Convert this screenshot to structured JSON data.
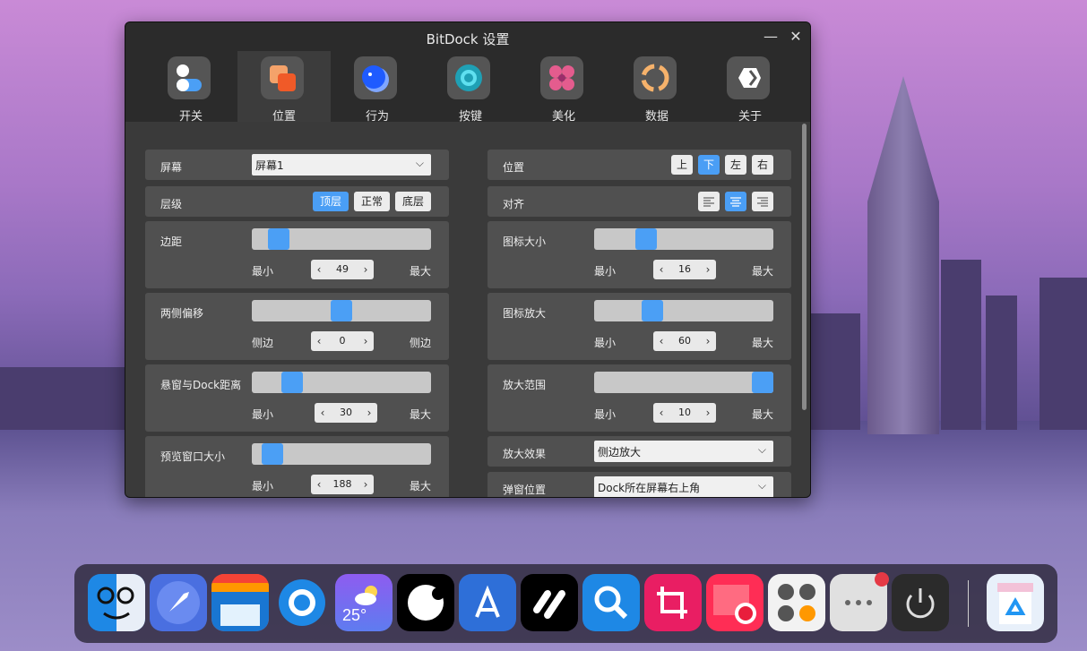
{
  "window": {
    "title": "BitDock 设置",
    "minimize_glyph": "—",
    "close_glyph": "✕"
  },
  "tabs": [
    {
      "label": "开关",
      "icon": "toggles-icon"
    },
    {
      "label": "位置",
      "icon": "layers-icon",
      "active": true
    },
    {
      "label": "行为",
      "icon": "circle-icon"
    },
    {
      "label": "按键",
      "icon": "ring-icon"
    },
    {
      "label": "美化",
      "icon": "flower-icon"
    },
    {
      "label": "数据",
      "icon": "refresh-ring-icon"
    },
    {
      "label": "关于",
      "icon": "hexagon-icon"
    }
  ],
  "left": {
    "screen": {
      "label": "屏幕",
      "value": "屏幕1"
    },
    "level": {
      "label": "层级",
      "options": [
        "顶层",
        "正常",
        "底层"
      ],
      "selected": "顶层"
    },
    "margin": {
      "label": "边距",
      "min": "最小",
      "max": "最大",
      "value": "49",
      "level": 0.1
    },
    "offset": {
      "label": "两侧偏移",
      "min": "侧边",
      "max": "侧边",
      "value": "0",
      "level": 0.5
    },
    "popup_gap": {
      "label": "悬窗与Dock距离",
      "min": "最小",
      "max": "最大",
      "value": "30",
      "level": 0.19
    },
    "preview": {
      "label": "预览窗口大小",
      "min": "最小",
      "max": "最大",
      "value": "188",
      "level": 0.06
    }
  },
  "right": {
    "position": {
      "label": "位置",
      "options": [
        "上",
        "下",
        "左",
        "右"
      ],
      "selected": "下"
    },
    "align": {
      "label": "对齐",
      "options": [
        "align-left-icon",
        "align-center-icon",
        "align-right-icon"
      ],
      "selected": "align-center-icon"
    },
    "icon_size": {
      "label": "图标大小",
      "min": "最小",
      "max": "最大",
      "value": "16",
      "level": 0.26
    },
    "icon_zoom": {
      "label": "图标放大",
      "min": "最小",
      "max": "最大",
      "value": "60",
      "level": 0.3
    },
    "zoom_range": {
      "label": "放大范围",
      "min": "最小",
      "max": "最大",
      "value": "10",
      "level": 1.0
    },
    "zoom_effect": {
      "label": "放大效果",
      "value": "侧边放大"
    },
    "popup_pos": {
      "label": "弹窗位置",
      "value": "Dock所在屏幕右上角"
    }
  },
  "dock": {
    "apps": [
      {
        "name": "finder-icon"
      },
      {
        "name": "rocket-icon"
      },
      {
        "name": "window-icon"
      },
      {
        "name": "settings-gear-icon"
      },
      {
        "name": "weather-icon",
        "text": "25°"
      },
      {
        "name": "arc-icon"
      },
      {
        "name": "app-store-icon"
      },
      {
        "name": "percent-icon"
      },
      {
        "name": "search-magnifier-icon"
      },
      {
        "name": "crop-icon"
      },
      {
        "name": "screen-record-icon"
      },
      {
        "name": "calculator-icon"
      },
      {
        "name": "more-icon"
      },
      {
        "name": "power-icon"
      },
      {
        "name": "recycle-bin-icon"
      }
    ]
  },
  "colors": {
    "accent": "#4b9ff5",
    "window_bg": "#2b2b2b",
    "row_bg": "#505050"
  }
}
